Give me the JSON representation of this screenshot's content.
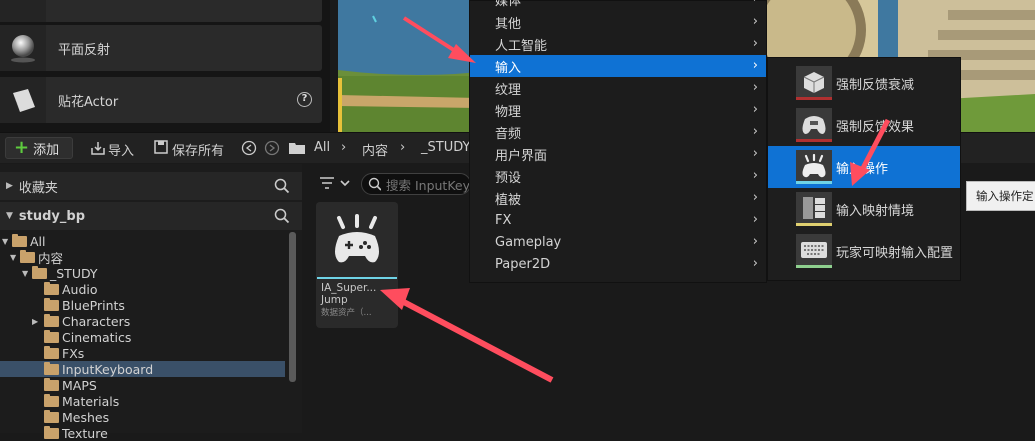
{
  "placement": {
    "items": [
      {
        "label": ""
      },
      {
        "label": "平面反射"
      },
      {
        "label": "贴花Actor"
      }
    ]
  },
  "toolbar": {
    "add_label": "添加",
    "import_label": "导入",
    "save_all_label": "保存所有",
    "breadcrumbs": [
      "All",
      "内容",
      "_STUDY"
    ]
  },
  "tree": {
    "favorites_label": "收藏夹",
    "project_label": "study_bp",
    "rows": [
      {
        "label": "All"
      },
      {
        "label": "内容"
      },
      {
        "label": "_STUDY"
      },
      {
        "label": "Audio"
      },
      {
        "label": "BluePrints"
      },
      {
        "label": "Characters"
      },
      {
        "label": "Cinematics"
      },
      {
        "label": "FXs"
      },
      {
        "label": "InputKeyboard"
      },
      {
        "label": "MAPS"
      },
      {
        "label": "Materials"
      },
      {
        "label": "Meshes"
      },
      {
        "label": "Texture"
      }
    ]
  },
  "search": {
    "placeholder": "搜索 InputKey"
  },
  "asset": {
    "name_line1": "IA_Super...",
    "name_line2": "Jump",
    "type": "数据资产（..."
  },
  "menu": {
    "items": [
      {
        "label": "媒体"
      },
      {
        "label": "其他"
      },
      {
        "label": "人工智能"
      },
      {
        "label": "输入"
      },
      {
        "label": "纹理"
      },
      {
        "label": "物理"
      },
      {
        "label": "音频"
      },
      {
        "label": "用户界面"
      },
      {
        "label": "预设"
      },
      {
        "label": "植被"
      },
      {
        "label": "FX"
      },
      {
        "label": "Gameplay"
      },
      {
        "label": "Paper2D"
      }
    ],
    "active_index": 3
  },
  "submenu": {
    "items": [
      {
        "label": "强制反馈衰减",
        "accent": "#b03030"
      },
      {
        "label": "强制反馈效果",
        "accent": "#b03030"
      },
      {
        "label": "输入操作",
        "accent": "#6fd3e6"
      },
      {
        "label": "输入映射情境",
        "accent": "#e0d070"
      },
      {
        "label": "玩家可映射输入配置",
        "accent": "#8fd08f"
      }
    ],
    "active_index": 2
  },
  "tooltip": {
    "text": "输入操作定"
  },
  "colors": {
    "accent": "#0f72d4",
    "annotation": "#ff4d5e"
  }
}
